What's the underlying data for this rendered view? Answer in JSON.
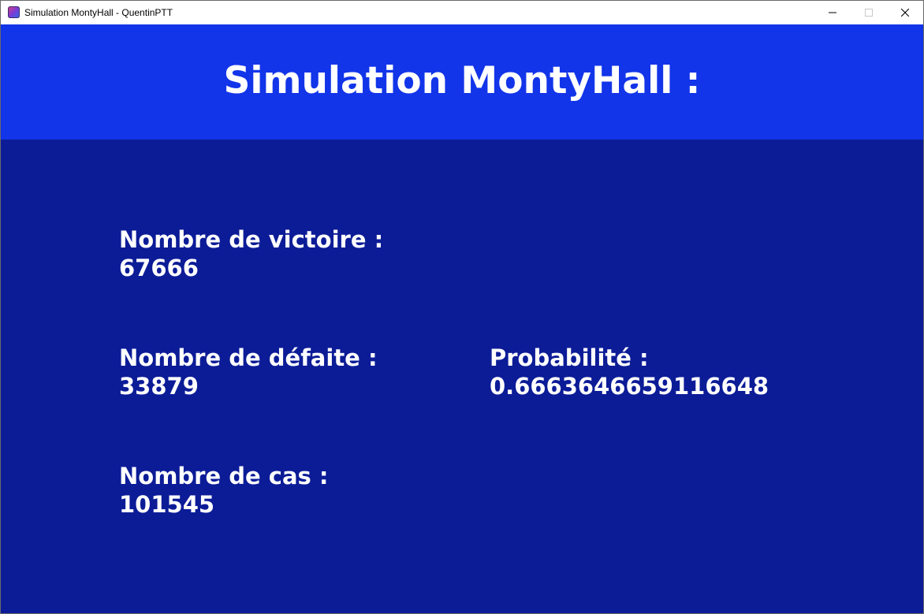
{
  "window": {
    "title": "Simulation MontyHall - QuentinPTT"
  },
  "header": {
    "title": "Simulation MontyHall :"
  },
  "stats": {
    "wins": {
      "label": "Nombre de victoire :",
      "value": "67666"
    },
    "losses": {
      "label": "Nombre de défaite :",
      "value": "33879"
    },
    "cases": {
      "label": "Nombre de cas :",
      "value": "101545"
    },
    "probability": {
      "label": "Probabilité :",
      "value": "0.6663646659116648"
    }
  },
  "colors": {
    "header_bg": "#1235e9",
    "body_bg": "#0c1c97",
    "text": "#ffffff"
  },
  "icons": {
    "app": "app-icon",
    "minimize": "minimize-icon",
    "maximize": "maximize-icon",
    "close": "close-icon"
  }
}
